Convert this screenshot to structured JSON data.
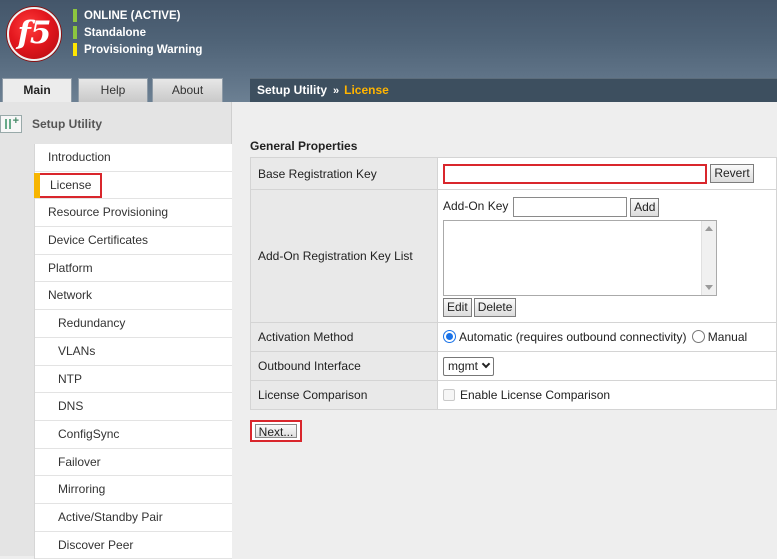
{
  "header": {
    "logo_text": "f5",
    "status": [
      {
        "text": "ONLINE (ACTIVE)",
        "color": "#8cc63f"
      },
      {
        "text": "Standalone",
        "color": "#8cc63f"
      },
      {
        "text": "Provisioning Warning",
        "color": "#ffe600"
      }
    ]
  },
  "tabs": [
    {
      "label": "Main",
      "active": true
    },
    {
      "label": "Help",
      "active": false
    },
    {
      "label": "About",
      "active": false
    }
  ],
  "breadcrumb": {
    "root": "Setup Utility",
    "separator": "»",
    "current": "License"
  },
  "sidebar": {
    "title": "Setup Utility",
    "items": [
      {
        "label": "Introduction"
      },
      {
        "label": "License",
        "active": true
      },
      {
        "label": "Resource Provisioning"
      },
      {
        "label": "Device Certificates"
      },
      {
        "label": "Platform"
      },
      {
        "label": "Network"
      },
      {
        "label": "Redundancy",
        "sub": true
      },
      {
        "label": "VLANs",
        "sub": true
      },
      {
        "label": "NTP",
        "sub": true
      },
      {
        "label": "DNS",
        "sub": true
      },
      {
        "label": "ConfigSync",
        "sub": true
      },
      {
        "label": "Failover",
        "sub": true
      },
      {
        "label": "Mirroring",
        "sub": true
      },
      {
        "label": "Active/Standby Pair",
        "sub": true
      },
      {
        "label": "Discover Peer",
        "sub": true
      }
    ]
  },
  "main": {
    "section_title": "General Properties",
    "base_key": {
      "label": "Base Registration Key",
      "value": "",
      "revert_label": "Revert"
    },
    "addon": {
      "label": "Add-On Registration Key List",
      "key_label": "Add-On Key",
      "key_value": "",
      "add_label": "Add",
      "edit_label": "Edit",
      "delete_label": "Delete"
    },
    "activation": {
      "label": "Activation Method",
      "option_automatic": "Automatic (requires outbound connectivity)",
      "option_manual": "Manual",
      "selected": "automatic"
    },
    "outbound": {
      "label": "Outbound Interface",
      "selected": "mgmt"
    },
    "comparison": {
      "label": "License Comparison",
      "checkbox_label": "Enable License Comparison",
      "checked": false
    },
    "next_label": "Next..."
  },
  "colors": {
    "accent": "#ffb400",
    "highlight_border": "#d9262c",
    "header_bg": "#4f6377"
  }
}
